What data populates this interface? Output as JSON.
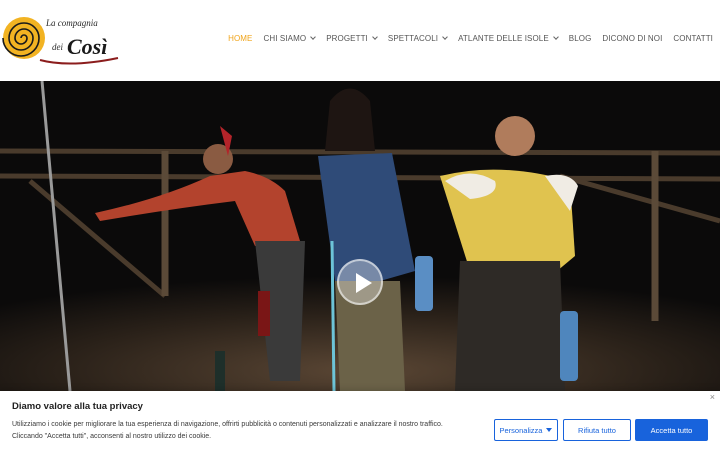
{
  "header": {
    "logo": {
      "line1": "La compagnia",
      "line2": "dei",
      "line3": "Così"
    },
    "nav": [
      {
        "label": "HOME",
        "active": true,
        "dropdown": false
      },
      {
        "label": "CHI SIAMO",
        "active": false,
        "dropdown": true
      },
      {
        "label": "PROGETTI",
        "active": false,
        "dropdown": true
      },
      {
        "label": "SPETTACOLI",
        "active": false,
        "dropdown": true
      },
      {
        "label": "ATLANTE DELLE ISOLE",
        "active": false,
        "dropdown": true
      },
      {
        "label": "BLOG",
        "active": false,
        "dropdown": false
      },
      {
        "label": "DICONO DI NOI",
        "active": false,
        "dropdown": false
      },
      {
        "label": "CONTATTI",
        "active": false,
        "dropdown": false
      }
    ]
  },
  "hero": {
    "icon": "play-icon"
  },
  "cookie": {
    "title": "Diamo valore alla tua privacy",
    "text_line1": "Utilizziamo i cookie per migliorare la tua esperienza di navigazione, offrirti pubblicità o contenuti personalizzati e analizzare il nostro traffico.",
    "text_line2": "Cliccando \"Accetta tutti\", acconsenti al nostro utilizzo dei cookie.",
    "customize_label": "Personalizza",
    "reject_label": "Rifiuta tutto",
    "accept_label": "Accetta tutto",
    "close_glyph": "×"
  },
  "colors": {
    "accent": "#f0a41a",
    "brand_blue": "#1863dc",
    "logo_red": "#8b1d1d"
  }
}
